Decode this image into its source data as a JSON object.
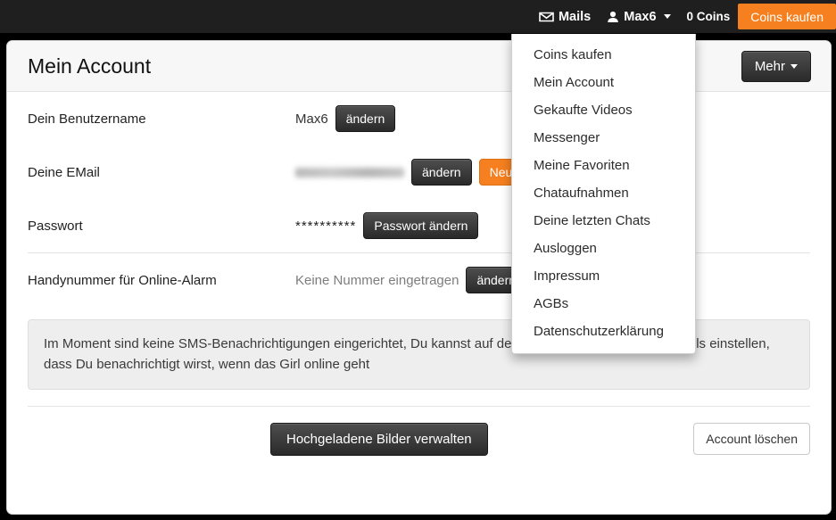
{
  "topbar": {
    "mails_label": "Mails",
    "user_label": "Max6",
    "coins_label": "0 Coins",
    "coins_buy_label": "Coins kaufen",
    "accent_color": "#f6801f",
    "background_color": "#1f1f1f"
  },
  "dropdown": {
    "items": [
      {
        "label": "Coins kaufen"
      },
      {
        "label": "Mein Account"
      },
      {
        "label": "Gekaufte Videos"
      },
      {
        "label": "Messenger"
      },
      {
        "label": "Meine Favoriten"
      },
      {
        "label": "Chataufnahmen"
      },
      {
        "label": "Deine letzten Chats"
      },
      {
        "label": "Ausloggen"
      },
      {
        "label": "Impressum"
      },
      {
        "label": "AGBs"
      },
      {
        "label": "Datenschutzerklärung"
      }
    ]
  },
  "card": {
    "title": "Mein Account",
    "more_button": "Mehr"
  },
  "rows": [
    {
      "label": "Dein Benutzername",
      "value": "Max6",
      "button": "ändern"
    },
    {
      "label": "Deine EMail",
      "value": "",
      "button": "ändern",
      "secondary_button": "Neu"
    },
    {
      "label": "Passwort",
      "value": "**********",
      "button": "Passwort ändern"
    },
    {
      "label": "Handynummer für Online-Alarm",
      "value": "Keine Nummer eingetragen",
      "button": "ändern"
    }
  ],
  "alert": {
    "text": "Im Moment sind keine SMS-Benachrichtigungen eingerichtet, Du kannst auf den Profilseiten der jeweiligen Girls einstellen, dass Du benachrichtigt wirst, wenn das Girl online geht"
  },
  "footer": {
    "manage_images_label": "Hochgeladene Bilder verwalten",
    "delete_account_label": "Account löschen"
  }
}
